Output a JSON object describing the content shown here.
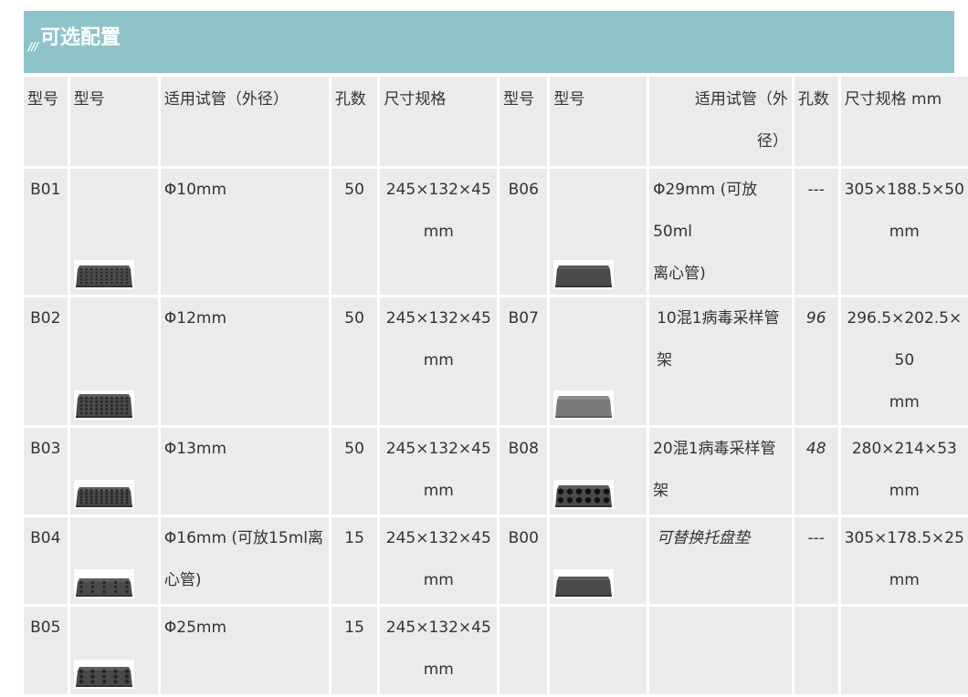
{
  "section": {
    "mark": "///",
    "title": "可选配置"
  },
  "headers": {
    "left": [
      "型号",
      "型号",
      "适用试管（外径）",
      "孔数",
      "尺寸规格"
    ],
    "right": [
      "型号",
      "型号",
      "适用试管（外\n径）",
      "孔数",
      "尺寸规格 mm"
    ]
  },
  "rows": [
    {
      "left": {
        "model": "B01",
        "tube": "Φ10mm",
        "holes": "50",
        "size": "245×132×45\nmm",
        "image": "foam-rack-10mm"
      },
      "right": {
        "model": "B06",
        "tube": "Φ29mm (可放50ml\n离心管)",
        "holes": "---",
        "size": "305×188.5×50\nmm",
        "image": "foam-rack-29mm"
      }
    },
    {
      "left": {
        "model": "B02",
        "tube": "Φ12mm",
        "holes": "50",
        "size": "245×132×45\nmm",
        "image": "foam-rack-12mm"
      },
      "right": {
        "model": "B07",
        "tube": "10混1病毒采样管架",
        "holes": "96",
        "size": "296.5×202.5×\n50\nmm",
        "image": "foam-rack-10in1"
      }
    },
    {
      "left": {
        "model": "B03",
        "tube": "Φ13mm",
        "holes": "50",
        "size": "245×132×45\nmm",
        "image": "foam-rack-13mm"
      },
      "right": {
        "model": "B08",
        "tube": "20混1病毒采样管架",
        "holes": "48",
        "size": "280×214×53\nmm",
        "image": "foam-rack-20in1"
      }
    },
    {
      "left": {
        "model": "B04",
        "tube": "Φ16mm (可放15ml离\n心管)",
        "holes": "15",
        "size": "245×132×45\nmm",
        "image": "foam-rack-16mm"
      },
      "right": {
        "model": "B00",
        "tube": "可替换托盘垫",
        "holes": "---",
        "size": "305×178.5×25\nmm",
        "image": "tray-pad"
      }
    },
    {
      "left": {
        "model": "B05",
        "tube": "Φ25mm",
        "holes": "15",
        "size": "245×132×45\nmm",
        "image": "foam-rack-25mm"
      },
      "right": {
        "model": "",
        "tube": "",
        "holes": "",
        "size": "",
        "image": ""
      }
    }
  ]
}
